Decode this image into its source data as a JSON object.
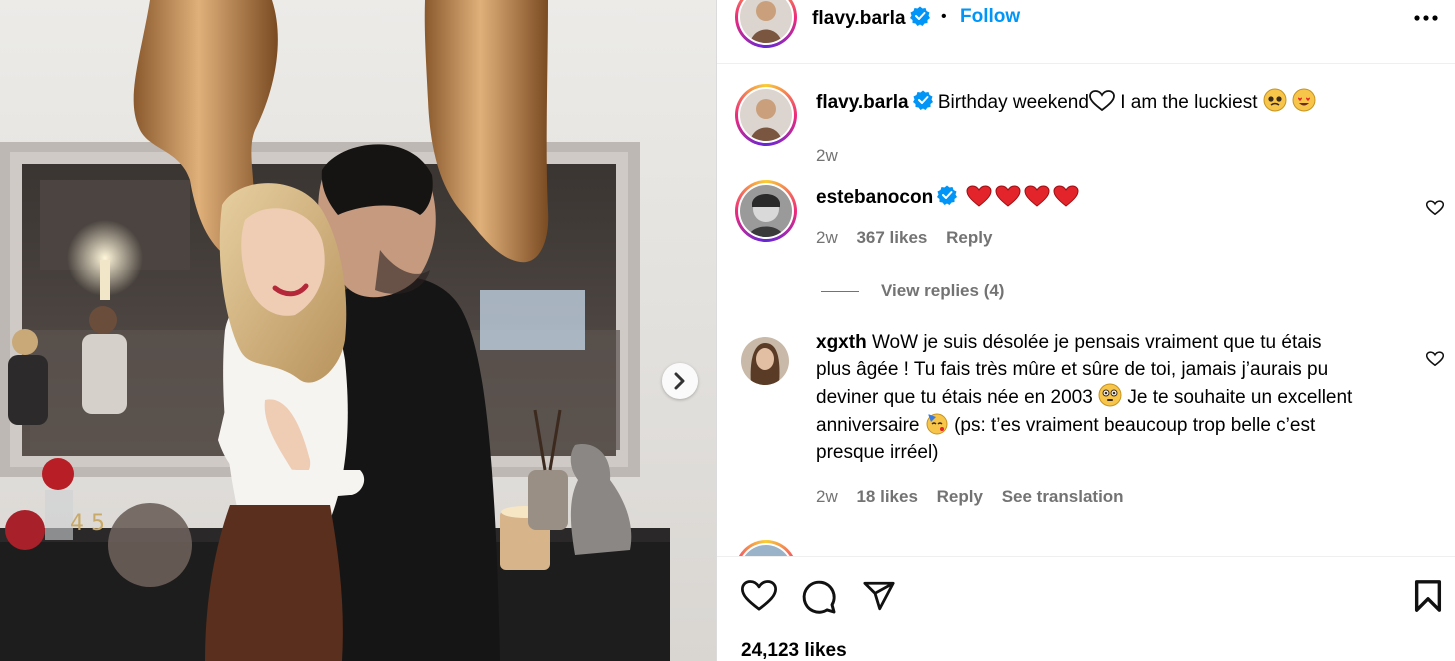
{
  "post": {
    "author": "flavy.barla",
    "follow_label": "Follow",
    "separator": "•",
    "caption_text": "Birthday weekend",
    "caption_text_2": "I am the luckiest",
    "caption_time": "2w",
    "likes_label": "24,123 likes"
  },
  "comments": [
    {
      "username": "estebanocon",
      "text": "",
      "time": "2w",
      "likes": "367 likes",
      "reply": "Reply",
      "view_replies": "View replies (4)"
    },
    {
      "username": "xgxth",
      "text_1": "WoW je suis désolée je pensais vraiment que tu étais",
      "text_2": "plus âgée ! Tu fais très mûre et sûre de toi, jamais j’aurais pu",
      "text_3": "deviner que tu étais née en 2003",
      "text_4a": "Je te souhaite un excellent",
      "text_4b": "anniversaire",
      "text_5": "(ps: t’es vraiment beaucoup trop belle c’est",
      "text_6": "presque irréel)",
      "time": "2w",
      "likes": "18 likes",
      "reply": "Reply",
      "translate": "See translation"
    }
  ],
  "colors": {
    "link": "#0095f6",
    "secondary_text": "#737373",
    "verified": "#0095f6",
    "heart_emoji": "#e3242b"
  },
  "icons": [
    "verified-badge-icon",
    "more-options-icon",
    "heart-outline-icon",
    "comment-icon",
    "share-icon",
    "bookmark-icon",
    "chevron-right-icon"
  ]
}
